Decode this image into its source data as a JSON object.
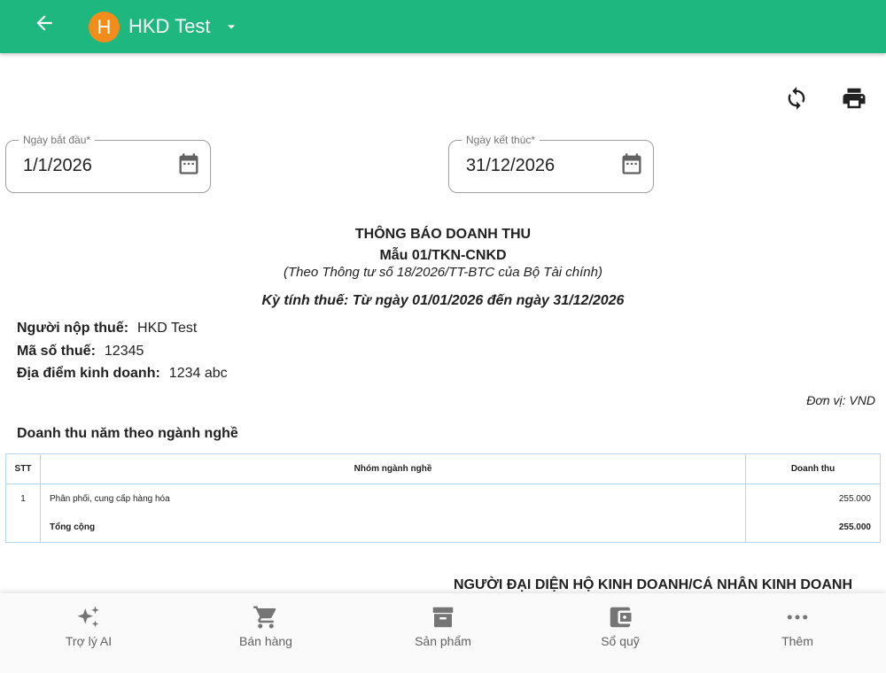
{
  "appbar": {
    "store_initial": "H",
    "store_name": "HKD Test",
    "bg_color": "#1db77f",
    "avatar_color": "#f28c1a"
  },
  "toolbar": {
    "icons": [
      "refresh-icon",
      "print-icon"
    ]
  },
  "filters": {
    "start": {
      "label": "Ngày bắt đầu*",
      "value": "1/1/2026"
    },
    "end": {
      "label": "Ngày kết thúc*",
      "value": "31/12/2026"
    }
  },
  "report": {
    "title": "THÔNG BÁO DOANH THU",
    "form": "Mẫu 01/TKN-CNKD",
    "circular": "(Theo Thông tư số 18/2026/TT-BTC của Bộ Tài chính)",
    "period": "Kỳ tính thuế: Từ ngày 01/01/2026 đến ngày 31/12/2026",
    "taxpayer_label": "Người nộp thuế:",
    "taxpayer_value": "HKD Test",
    "tax_code_label": "Mã số thuế:",
    "tax_code_value": "12345",
    "location_label": "Địa điểm kinh doanh:",
    "location_value": "1234 abc",
    "unit": "Đơn vị: VND",
    "section_title": "Doanh thu năm theo ngành nghề",
    "signature": "NGƯỜI ĐẠI DIỆN HỘ KINH DOANH/CÁ NHÂN KINH DOANH"
  },
  "table": {
    "headers": [
      "STT",
      "Nhóm ngành nghề",
      "Doanh thu"
    ],
    "rows": [
      {
        "stt": "1",
        "group": "Phân phối, cung cấp hàng hóa",
        "revenue": "255.000"
      }
    ],
    "total_label": "Tổng cộng",
    "total_value": "255.000"
  },
  "bottom_nav": {
    "items": [
      {
        "label": "Trợ lý AI",
        "icon": "sparkles-icon"
      },
      {
        "label": "Bán hàng",
        "icon": "cart-icon"
      },
      {
        "label": "Sản phẩm",
        "icon": "archive-box-icon"
      },
      {
        "label": "Sổ quỹ",
        "icon": "wallet-icon"
      },
      {
        "label": "Thêm",
        "icon": "more-horizontal-icon"
      }
    ]
  }
}
